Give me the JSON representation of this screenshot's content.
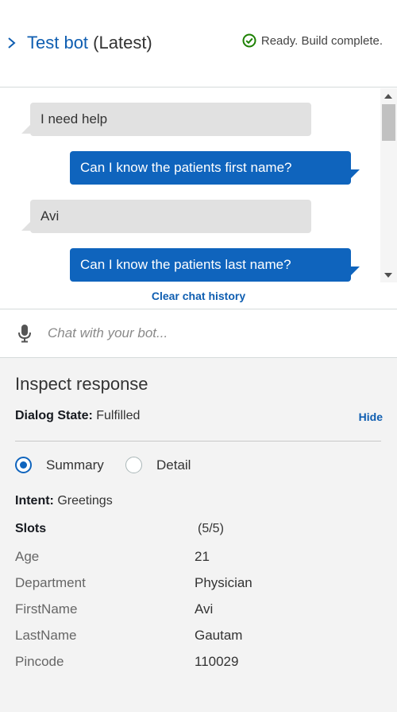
{
  "header": {
    "bot_name": "Test bot",
    "version": "(Latest)",
    "status": "Ready. Build complete.",
    "status_color": "#1d8102"
  },
  "chat": {
    "messages": [
      {
        "from": "user",
        "text": "I need help"
      },
      {
        "from": "bot",
        "text": "Can I know the patients first name?"
      },
      {
        "from": "user",
        "text": "Avi"
      },
      {
        "from": "bot",
        "text": "Can I know the patients last name?"
      }
    ],
    "clear_label": "Clear chat history"
  },
  "input": {
    "placeholder": "Chat with your bot...",
    "icon": "microphone-icon"
  },
  "inspect": {
    "title": "Inspect response",
    "dialog_state_label": "Dialog State:",
    "dialog_state_value": "Fulfilled",
    "hide_label": "Hide",
    "view_options": [
      {
        "label": "Summary",
        "selected": true
      },
      {
        "label": "Detail",
        "selected": false
      }
    ],
    "intent_label": "Intent:",
    "intent_value": "Greetings",
    "slots_label": "Slots",
    "slots_count": "(5/5)",
    "slots": [
      {
        "name": "Age",
        "value": "21"
      },
      {
        "name": "Department",
        "value": "Physician"
      },
      {
        "name": "FirstName",
        "value": "Avi"
      },
      {
        "name": "LastName",
        "value": "Gautam"
      },
      {
        "name": "Pincode",
        "value": "110029"
      }
    ]
  },
  "colors": {
    "accent": "#0f64bd",
    "user_bubble": "#e1e1e1",
    "panel_bg": "#f3f3f3"
  }
}
